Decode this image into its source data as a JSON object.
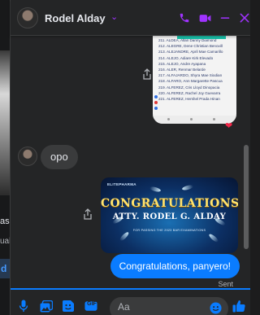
{
  "background_page": {
    "fragment_1": "as",
    "fragment_2": "ual",
    "fragment_3": "d"
  },
  "header": {
    "contact_name": "Rodel Alday",
    "name_chevron": "⌄",
    "accent_color": "#a033ff",
    "icons": [
      "phone-icon",
      "video-camera-icon",
      "minimize-icon",
      "close-icon"
    ]
  },
  "messages": {
    "list_image": {
      "lines": [
        "211. ALDEA, Allan Danny Diamond",
        "212. ALEGRE, Dene Christian Benovill",
        "213. ALEJANDRE, April Mae Camarillo",
        "214. ALEJO, Adiare Kirk Elevado",
        "215. ALEJO, Andre Ayapana",
        "216. ALER, Renmar Belarde",
        "217. ALFAJARDO, Shyra Mae Siodian",
        "218. ALFARO, Ann Margarette Pascua",
        "219. ALFEREZ, Cris Lloyd Dinopacia",
        "220. ALFEREZ, Rachel Joy Guevarra",
        "221. ALFEREZ, Hershel Prada Hinan"
      ],
      "reaction": "❤"
    },
    "received_text": "opo",
    "congrats_image": {
      "brand": "ELITEPHARMA",
      "title": "CONGRATULATIONS!",
      "name": "ATTY. RODEL G. ALDAY",
      "subtitle": "FOR PASSING THE 2023 BAR EXAMINATIONS"
    },
    "sent_text": "Congratulations, panyero!",
    "sent_status": "Sent",
    "sent_color": "#0a7cff"
  },
  "composer": {
    "placeholder": "Aa",
    "icons": [
      "microphone-icon",
      "photo-icon",
      "sticker-icon",
      "gif-icon",
      "emoji-icon",
      "thumbs-up-icon"
    ],
    "gif_label": "GIF"
  }
}
